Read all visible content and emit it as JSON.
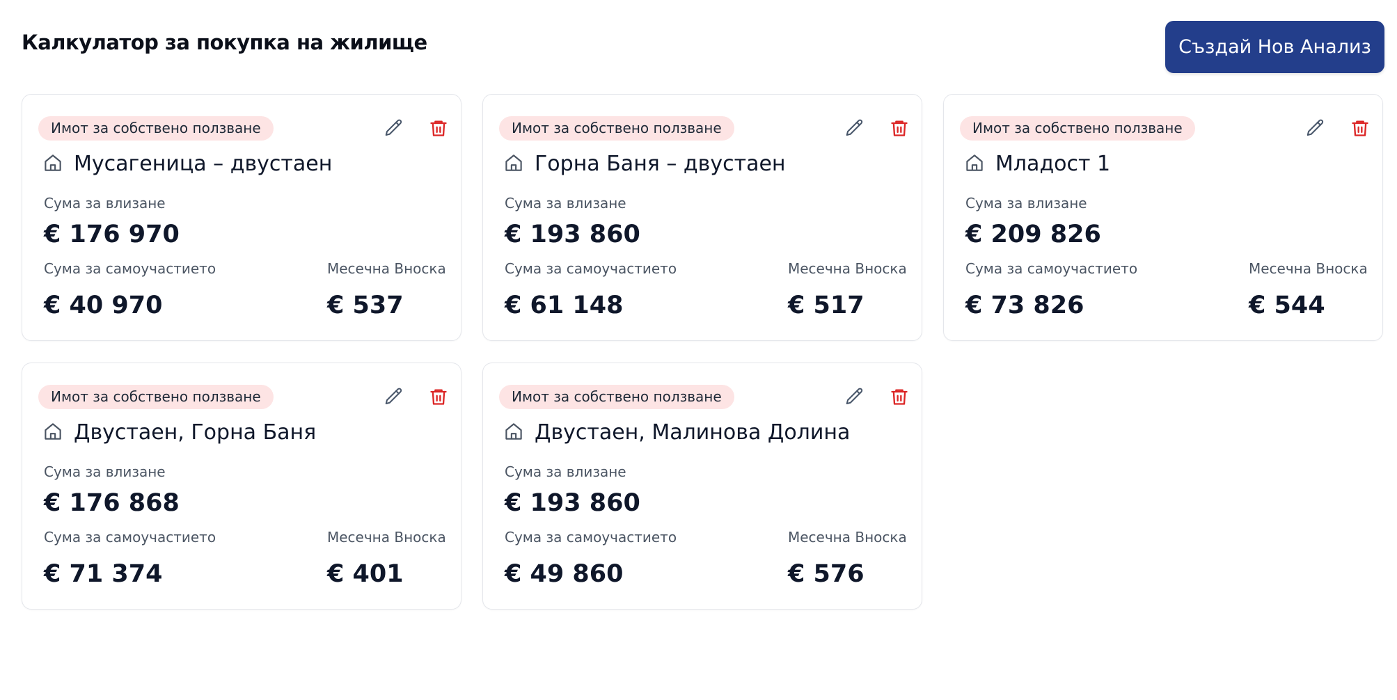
{
  "header": {
    "title": "Калкулатор за покупка на жилище",
    "new_button_label": "Създай Нов Анализ"
  },
  "labels": {
    "entry": "Сума за влизане",
    "self": "Сума за самоучастието",
    "monthly": "Месечна Вноска"
  },
  "icons": {
    "home": "home-icon",
    "edit": "pencil-icon",
    "delete": "trash-icon"
  },
  "colors": {
    "primary": "#233e8b",
    "tag_bg": "#fde4e4",
    "delete": "#dc2626"
  },
  "cards": [
    {
      "tag": "Имот за собствено ползване",
      "title": "Мусагеница – двустаен",
      "entry": "€ 176 970",
      "self": "€ 40 970",
      "monthly": "€ 537"
    },
    {
      "tag": "Имот за собствено ползване",
      "title": "Горна Баня – двустаен",
      "entry": "€ 193 860",
      "self": "€ 61 148",
      "monthly": "€ 517"
    },
    {
      "tag": "Имот за собствено ползване",
      "title": "Младост 1",
      "entry": "€ 209 826",
      "self": "€ 73 826",
      "monthly": "€ 544"
    },
    {
      "tag": "Имот за собствено ползване",
      "title": "Двустаен, Горна Баня",
      "entry": "€ 176 868",
      "self": "€ 71 374",
      "monthly": "€ 401"
    },
    {
      "tag": "Имот за собствено ползване",
      "title": "Двустаен, Малинова Долина",
      "entry": "€ 193 860",
      "self": "€ 49 860",
      "monthly": "€ 576"
    }
  ]
}
